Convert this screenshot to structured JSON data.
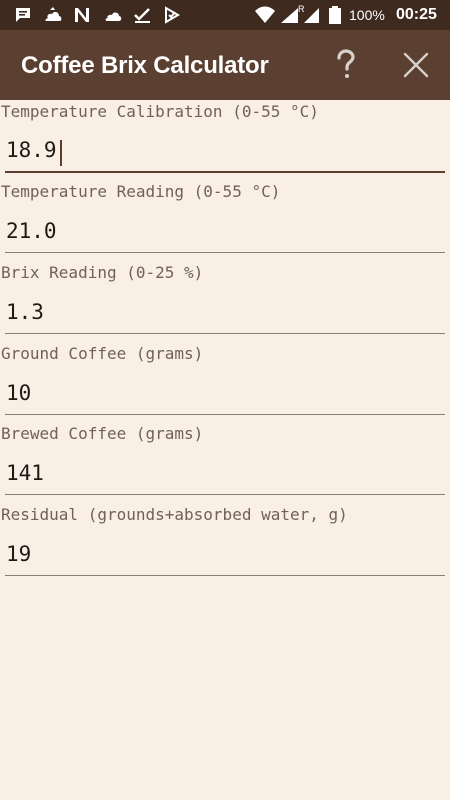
{
  "status_bar": {
    "icons": [
      "message-icon",
      "cloud-pie-icon",
      "n-logo-icon",
      "cloud-icon",
      "checkmark-icon",
      "checkbox-flag-icon",
      "wifi-icon",
      "signal-r-icon",
      "signal-icon",
      "battery-icon"
    ],
    "roaming_label": "R",
    "battery": "100%",
    "time": "00:25"
  },
  "app_bar": {
    "title": "Coffee Brix Calculator",
    "help_icon": "question-mark-icon",
    "close_icon": "close-icon"
  },
  "fields": [
    {
      "label": "Temperature Calibration (0-55 °C)",
      "value": "18.9"
    },
    {
      "label": "Temperature Reading (0-55 °C)",
      "value": "21.0"
    },
    {
      "label": "Brix Reading (0-25 %)",
      "value": "1.3"
    },
    {
      "label": "Ground Coffee (grams)",
      "value": "10"
    },
    {
      "label": "Brewed Coffee (grams)",
      "value": "141"
    },
    {
      "label": "Residual (grounds+absorbed water, g)",
      "value": "19"
    }
  ],
  "colors": {
    "status_bar": "#3E2A1F",
    "app_bar": "#5B3F31",
    "background": "#FAEFE4",
    "accent": "#5B3F31"
  }
}
